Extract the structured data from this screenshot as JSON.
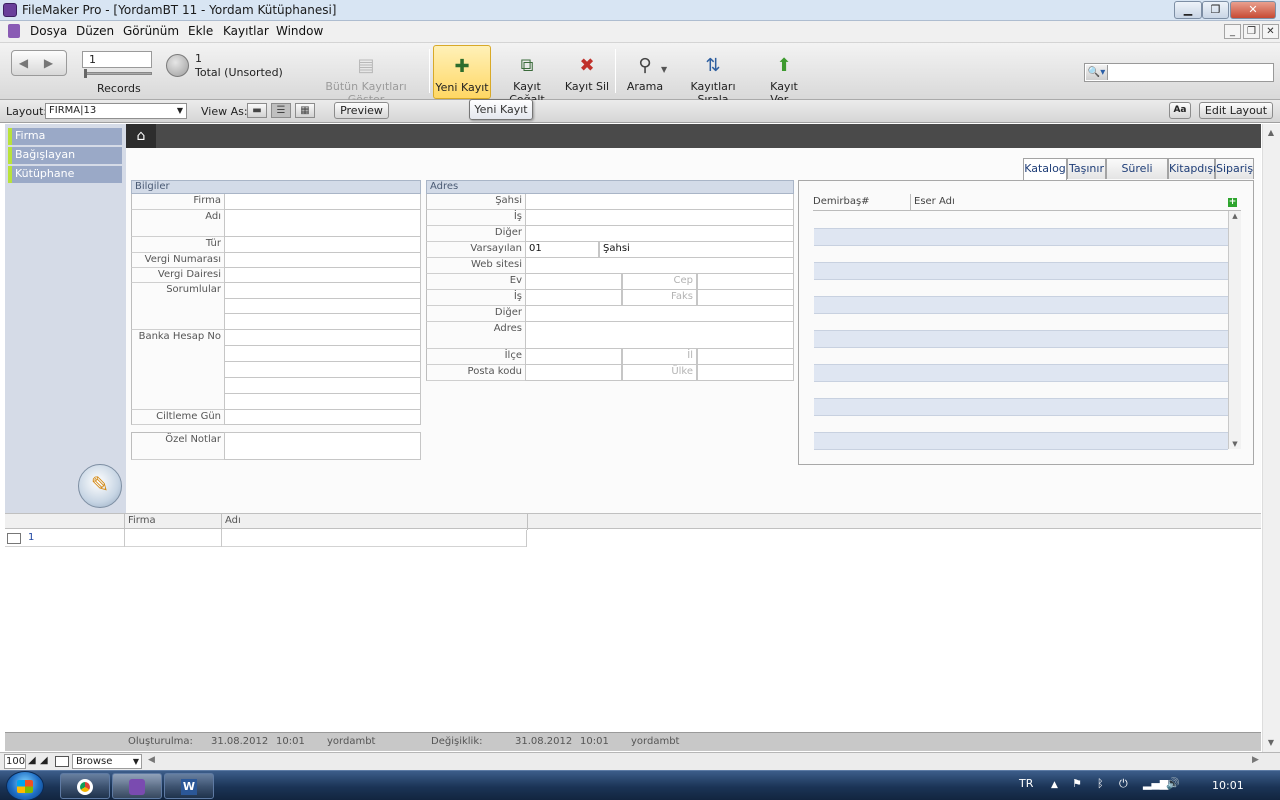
{
  "window": {
    "title": "FileMaker Pro - [YordamBT 11 - Yordam Kütüphanesi]"
  },
  "menu": [
    "Dosya",
    "Düzen",
    "Görünüm",
    "Ekle",
    "Kayıtlar",
    "Window"
  ],
  "toolbar": {
    "record_number": "1",
    "records_label": "Records",
    "found_count": "1",
    "total_label": "Total (Unsorted)",
    "buttons": [
      {
        "label": "Bütün Kayıtları Göster",
        "icon": "show-all-icon",
        "enabled": false
      },
      {
        "label": "Yeni Kayıt",
        "icon": "new-record-icon",
        "active": true
      },
      {
        "label": "Kayıt Çoğalt",
        "icon": "duplicate-record-icon"
      },
      {
        "label": "Kayıt Sil",
        "icon": "delete-record-icon"
      },
      {
        "label": "Arama",
        "icon": "search-icon"
      },
      {
        "label": "Kayıtları Sırala",
        "icon": "sort-icon"
      },
      {
        "label": "Kayıt Ver...",
        "icon": "share-icon"
      }
    ],
    "search_placeholder": ""
  },
  "layout_bar": {
    "layout_label": "Layout:",
    "layout_value": "FIRMA|13",
    "view_as_label": "View As:",
    "preview_label": "Preview",
    "aa_label": "Aa",
    "edit_layout_label": "Edit Layout"
  },
  "tooltip": "Yeni Kayıt",
  "sidebar_nav": [
    "Firma",
    "Bağışlayan",
    "Kütüphane"
  ],
  "bilgiler": {
    "header": "Bilgiler",
    "fields": {
      "firma": "Firma",
      "adi": "Adı",
      "tur": "Tür",
      "vergi_no": "Vergi Numarası",
      "vergi_dairesi": "Vergi Dairesi",
      "sorumlular": "Sorumlular",
      "banka": "Banka Hesap No",
      "ciltleme": "Ciltleme Gün"
    },
    "ozel_notlar": "Özel Notlar"
  },
  "adres": {
    "header": "Adres",
    "sahsi": "Şahsi",
    "is": "İş",
    "diger": "Diğer",
    "varsayilan": "Varsayılan",
    "varsayilan_code": "01",
    "varsayilan_value": "Şahsi",
    "web": "Web sitesi",
    "ev": "Ev",
    "cep": "Cep",
    "is2": "İş",
    "faks": "Faks",
    "diger2": "Diğer",
    "adres": "Adres",
    "ilce": "İlçe",
    "il": "İl",
    "posta": "Posta kodu",
    "ulke": "Ülke"
  },
  "tabs": [
    "Katalog",
    "Taşınır",
    "Süreli Takip",
    "Kitapdışı",
    "Sipariş"
  ],
  "portal": {
    "col1": "Demirbaş#",
    "col2": "Eser Adı",
    "add_icon": "+"
  },
  "list": {
    "col_firma": "Firma",
    "col_adi": "Adı",
    "row_number": "1"
  },
  "footer": {
    "created_label": "Oluşturulma:",
    "created_date": "31.08.2012",
    "created_time": "10:01",
    "created_user": "yordambt",
    "modified_label": "Değişiklik:",
    "modified_date": "31.08.2012",
    "modified_time": "10:01",
    "modified_user": "yordambt"
  },
  "status": {
    "zoom": "100",
    "mode": "Browse"
  },
  "taskbar": {
    "lang": "TR",
    "clock": "10:01"
  }
}
